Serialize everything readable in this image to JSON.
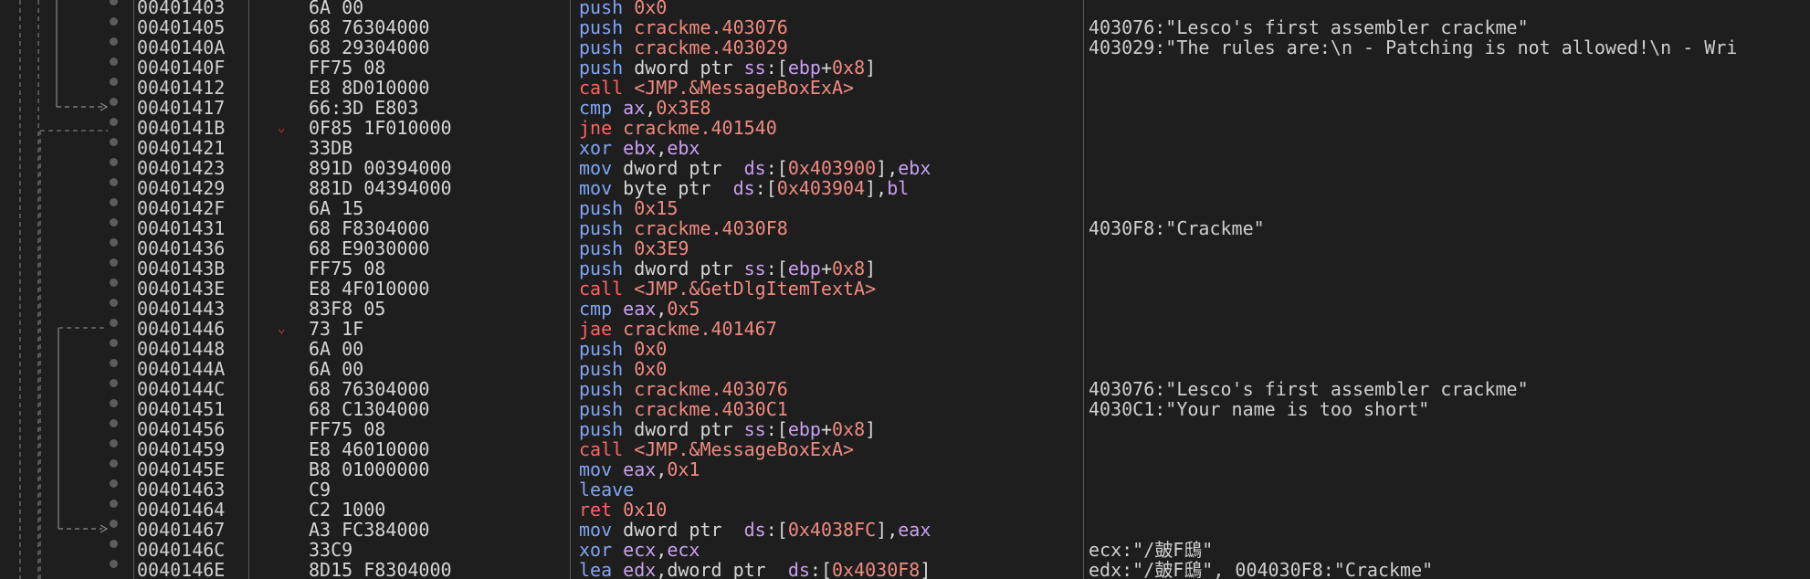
{
  "view": {
    "title": ""
  },
  "rows": [
    {
      "addr": "00401403",
      "bytes": "6A 00",
      "jump_marker": "",
      "parts": [
        [
          "push",
          "mn-push"
        ],
        [
          " ",
          "def"
        ],
        [
          "0x0",
          "num"
        ]
      ],
      "comment": ""
    },
    {
      "addr": "00401405",
      "bytes": "68 76304000",
      "jump_marker": "",
      "parts": [
        [
          "push",
          "mn-push"
        ],
        [
          " ",
          "def"
        ],
        [
          "crackme.403076",
          "tgt"
        ]
      ],
      "comment": "403076:\"Lesco's first assembler crackme\""
    },
    {
      "addr": "0040140A",
      "bytes": "68 29304000",
      "jump_marker": "",
      "parts": [
        [
          "push",
          "mn-push"
        ],
        [
          " ",
          "def"
        ],
        [
          "crackme.403029",
          "tgt"
        ]
      ],
      "comment": "403029:\"The rules are:\\n - Patching is not allowed!\\n - Wri"
    },
    {
      "addr": "0040140F",
      "bytes": "FF75 08",
      "jump_marker": "",
      "parts": [
        [
          "push",
          "mn-push"
        ],
        [
          " ",
          "def"
        ],
        [
          "dword ptr ",
          "kw"
        ],
        [
          "ss",
          "seg"
        ],
        [
          ":[",
          "def"
        ],
        [
          "ebp",
          "reg"
        ],
        [
          "+",
          "def"
        ],
        [
          "0x8",
          "num"
        ],
        [
          "]",
          "def"
        ]
      ],
      "comment": ""
    },
    {
      "addr": "00401412",
      "bytes": "E8 8D010000",
      "jump_marker": "",
      "parts": [
        [
          "call",
          "mn-call"
        ],
        [
          " ",
          "def"
        ],
        [
          "<JMP.&MessageBoxExA>",
          "tgt"
        ]
      ],
      "comment": ""
    },
    {
      "addr": "00401417",
      "bytes": "66:3D E803",
      "jump_marker": "",
      "parts": [
        [
          "cmp",
          "mn-cmp"
        ],
        [
          " ",
          "def"
        ],
        [
          "ax",
          "reg"
        ],
        [
          ",",
          "def"
        ],
        [
          "0x3E8",
          "num"
        ]
      ],
      "comment": ""
    },
    {
      "addr": "0040141B",
      "bytes": "0F85 1F010000",
      "jump_marker": "v",
      "parts": [
        [
          "jne",
          "mn-jcc"
        ],
        [
          " ",
          "def"
        ],
        [
          "crackme.401540",
          "tgt"
        ]
      ],
      "comment": ""
    },
    {
      "addr": "00401421",
      "bytes": "33DB",
      "jump_marker": "",
      "parts": [
        [
          "xor",
          "mn-std"
        ],
        [
          " ",
          "def"
        ],
        [
          "ebx",
          "reg"
        ],
        [
          ",",
          "def"
        ],
        [
          "ebx",
          "reg"
        ]
      ],
      "comment": ""
    },
    {
      "addr": "00401423",
      "bytes": "891D 00394000",
      "jump_marker": "",
      "parts": [
        [
          "mov",
          "mn-std"
        ],
        [
          " ",
          "def"
        ],
        [
          "dword ptr ",
          "kw"
        ],
        [
          " ",
          "def"
        ],
        [
          "ds",
          "seg"
        ],
        [
          ":[",
          "def"
        ],
        [
          "0x403900",
          "num"
        ],
        [
          "],",
          "def"
        ],
        [
          "ebx",
          "reg"
        ]
      ],
      "comment": ""
    },
    {
      "addr": "00401429",
      "bytes": "881D 04394000",
      "jump_marker": "",
      "parts": [
        [
          "mov",
          "mn-std"
        ],
        [
          " ",
          "def"
        ],
        [
          "byte ptr ",
          "kw"
        ],
        [
          " ",
          "def"
        ],
        [
          "ds",
          "seg"
        ],
        [
          ":[",
          "def"
        ],
        [
          "0x403904",
          "num"
        ],
        [
          "],",
          "def"
        ],
        [
          "bl",
          "reg"
        ]
      ],
      "comment": ""
    },
    {
      "addr": "0040142F",
      "bytes": "6A 15",
      "jump_marker": "",
      "parts": [
        [
          "push",
          "mn-push"
        ],
        [
          " ",
          "def"
        ],
        [
          "0x15",
          "num"
        ]
      ],
      "comment": ""
    },
    {
      "addr": "00401431",
      "bytes": "68 F8304000",
      "jump_marker": "",
      "parts": [
        [
          "push",
          "mn-push"
        ],
        [
          " ",
          "def"
        ],
        [
          "crackme.4030F8",
          "tgt"
        ]
      ],
      "comment": "4030F8:\"Crackme\""
    },
    {
      "addr": "00401436",
      "bytes": "68 E9030000",
      "jump_marker": "",
      "parts": [
        [
          "push",
          "mn-push"
        ],
        [
          " ",
          "def"
        ],
        [
          "0x3E9",
          "num"
        ]
      ],
      "comment": ""
    },
    {
      "addr": "0040143B",
      "bytes": "FF75 08",
      "jump_marker": "",
      "parts": [
        [
          "push",
          "mn-push"
        ],
        [
          " ",
          "def"
        ],
        [
          "dword ptr ",
          "kw"
        ],
        [
          "ss",
          "seg"
        ],
        [
          ":[",
          "def"
        ],
        [
          "ebp",
          "reg"
        ],
        [
          "+",
          "def"
        ],
        [
          "0x8",
          "num"
        ],
        [
          "]",
          "def"
        ]
      ],
      "comment": ""
    },
    {
      "addr": "0040143E",
      "bytes": "E8 4F010000",
      "jump_marker": "",
      "parts": [
        [
          "call",
          "mn-call"
        ],
        [
          " ",
          "def"
        ],
        [
          "<JMP.&GetDlgItemTextA>",
          "tgt"
        ]
      ],
      "comment": ""
    },
    {
      "addr": "00401443",
      "bytes": "83F8 05",
      "jump_marker": "",
      "parts": [
        [
          "cmp",
          "mn-cmp"
        ],
        [
          " ",
          "def"
        ],
        [
          "eax",
          "reg"
        ],
        [
          ",",
          "def"
        ],
        [
          "0x5",
          "num"
        ]
      ],
      "comment": ""
    },
    {
      "addr": "00401446",
      "bytes": "73 1F",
      "jump_marker": "v",
      "parts": [
        [
          "jae",
          "mn-jcc"
        ],
        [
          " ",
          "def"
        ],
        [
          "crackme.401467",
          "tgt"
        ]
      ],
      "comment": ""
    },
    {
      "addr": "00401448",
      "bytes": "6A 00",
      "jump_marker": "",
      "parts": [
        [
          "push",
          "mn-push"
        ],
        [
          " ",
          "def"
        ],
        [
          "0x0",
          "num"
        ]
      ],
      "comment": ""
    },
    {
      "addr": "0040144A",
      "bytes": "6A 00",
      "jump_marker": "",
      "parts": [
        [
          "push",
          "mn-push"
        ],
        [
          " ",
          "def"
        ],
        [
          "0x0",
          "num"
        ]
      ],
      "comment": ""
    },
    {
      "addr": "0040144C",
      "bytes": "68 76304000",
      "jump_marker": "",
      "parts": [
        [
          "push",
          "mn-push"
        ],
        [
          " ",
          "def"
        ],
        [
          "crackme.403076",
          "tgt"
        ]
      ],
      "comment": "403076:\"Lesco's first assembler crackme\""
    },
    {
      "addr": "00401451",
      "bytes": "68 C1304000",
      "jump_marker": "",
      "parts": [
        [
          "push",
          "mn-push"
        ],
        [
          " ",
          "def"
        ],
        [
          "crackme.4030C1",
          "tgt"
        ]
      ],
      "comment": "4030C1:\"Your name is too short\""
    },
    {
      "addr": "00401456",
      "bytes": "FF75 08",
      "jump_marker": "",
      "parts": [
        [
          "push",
          "mn-push"
        ],
        [
          " ",
          "def"
        ],
        [
          "dword ptr ",
          "kw"
        ],
        [
          "ss",
          "seg"
        ],
        [
          ":[",
          "def"
        ],
        [
          "ebp",
          "reg"
        ],
        [
          "+",
          "def"
        ],
        [
          "0x8",
          "num"
        ],
        [
          "]",
          "def"
        ]
      ],
      "comment": ""
    },
    {
      "addr": "00401459",
      "bytes": "E8 46010000",
      "jump_marker": "",
      "parts": [
        [
          "call",
          "mn-call"
        ],
        [
          " ",
          "def"
        ],
        [
          "<JMP.&MessageBoxExA>",
          "tgt"
        ]
      ],
      "comment": ""
    },
    {
      "addr": "0040145E",
      "bytes": "B8 01000000",
      "jump_marker": "",
      "parts": [
        [
          "mov",
          "mn-std"
        ],
        [
          " ",
          "def"
        ],
        [
          "eax",
          "reg"
        ],
        [
          ",",
          "def"
        ],
        [
          "0x1",
          "num"
        ]
      ],
      "comment": ""
    },
    {
      "addr": "00401463",
      "bytes": "C9",
      "jump_marker": "",
      "parts": [
        [
          "leave",
          "mn-std"
        ]
      ],
      "comment": ""
    },
    {
      "addr": "00401464",
      "bytes": "C2 1000",
      "jump_marker": "",
      "parts": [
        [
          "ret",
          "mn-ret"
        ],
        [
          " ",
          "def"
        ],
        [
          "0x10",
          "num"
        ]
      ],
      "comment": ""
    },
    {
      "addr": "00401467",
      "bytes": "A3 FC384000",
      "jump_marker": "",
      "parts": [
        [
          "mov",
          "mn-std"
        ],
        [
          " ",
          "def"
        ],
        [
          "dword ptr ",
          "kw"
        ],
        [
          " ",
          "def"
        ],
        [
          "ds",
          "seg"
        ],
        [
          ":[",
          "def"
        ],
        [
          "0x4038FC",
          "num"
        ],
        [
          "],",
          "def"
        ],
        [
          "eax",
          "reg"
        ]
      ],
      "comment": ""
    },
    {
      "addr": "0040146C",
      "bytes": "33C9",
      "jump_marker": "",
      "parts": [
        [
          "xor",
          "mn-std"
        ],
        [
          " ",
          "def"
        ],
        [
          "ecx",
          "reg"
        ],
        [
          ",",
          "def"
        ],
        [
          "ecx",
          "reg"
        ]
      ],
      "comment": "ecx:\"/皷F鴟\""
    },
    {
      "addr": "0040146E",
      "bytes": "8D15 F8304000",
      "jump_marker": "",
      "parts": [
        [
          "lea",
          "mn-std"
        ],
        [
          " ",
          "def"
        ],
        [
          "edx",
          "reg"
        ],
        [
          ",",
          "def"
        ],
        [
          "dword ptr ",
          "kw"
        ],
        [
          " ",
          "def"
        ],
        [
          "ds",
          "seg"
        ],
        [
          ":[",
          "def"
        ],
        [
          "0x4030F8",
          "num"
        ],
        [
          "]",
          "def"
        ]
      ],
      "comment": "edx:\"/皷F鴟\", 004030F8:\"Crackme\""
    }
  ]
}
